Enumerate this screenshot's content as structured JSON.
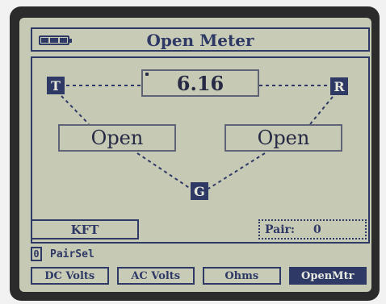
{
  "header": {
    "title": "Open Meter",
    "battery_icon": "battery-icon"
  },
  "diagram": {
    "tip_label": "T",
    "ring_label": "R",
    "ground_label": "G",
    "reading": "6.16",
    "tip_status": "Open",
    "ring_status": "Open"
  },
  "footer": {
    "units_label": "KFT",
    "pair_label": "Pair:",
    "pair_value": "0"
  },
  "pairsel": {
    "index": "0",
    "label": "PairSel"
  },
  "softkeys": [
    {
      "label": "DC Volts",
      "active": false
    },
    {
      "label": "AC Volts",
      "active": false
    },
    {
      "label": "Ohms",
      "active": false
    },
    {
      "label": "OpenMtr",
      "active": true
    }
  ],
  "colors": {
    "lcd_background": "#c6c9b4",
    "ink": "#2f3966",
    "bezel": "#2b2b2b"
  }
}
